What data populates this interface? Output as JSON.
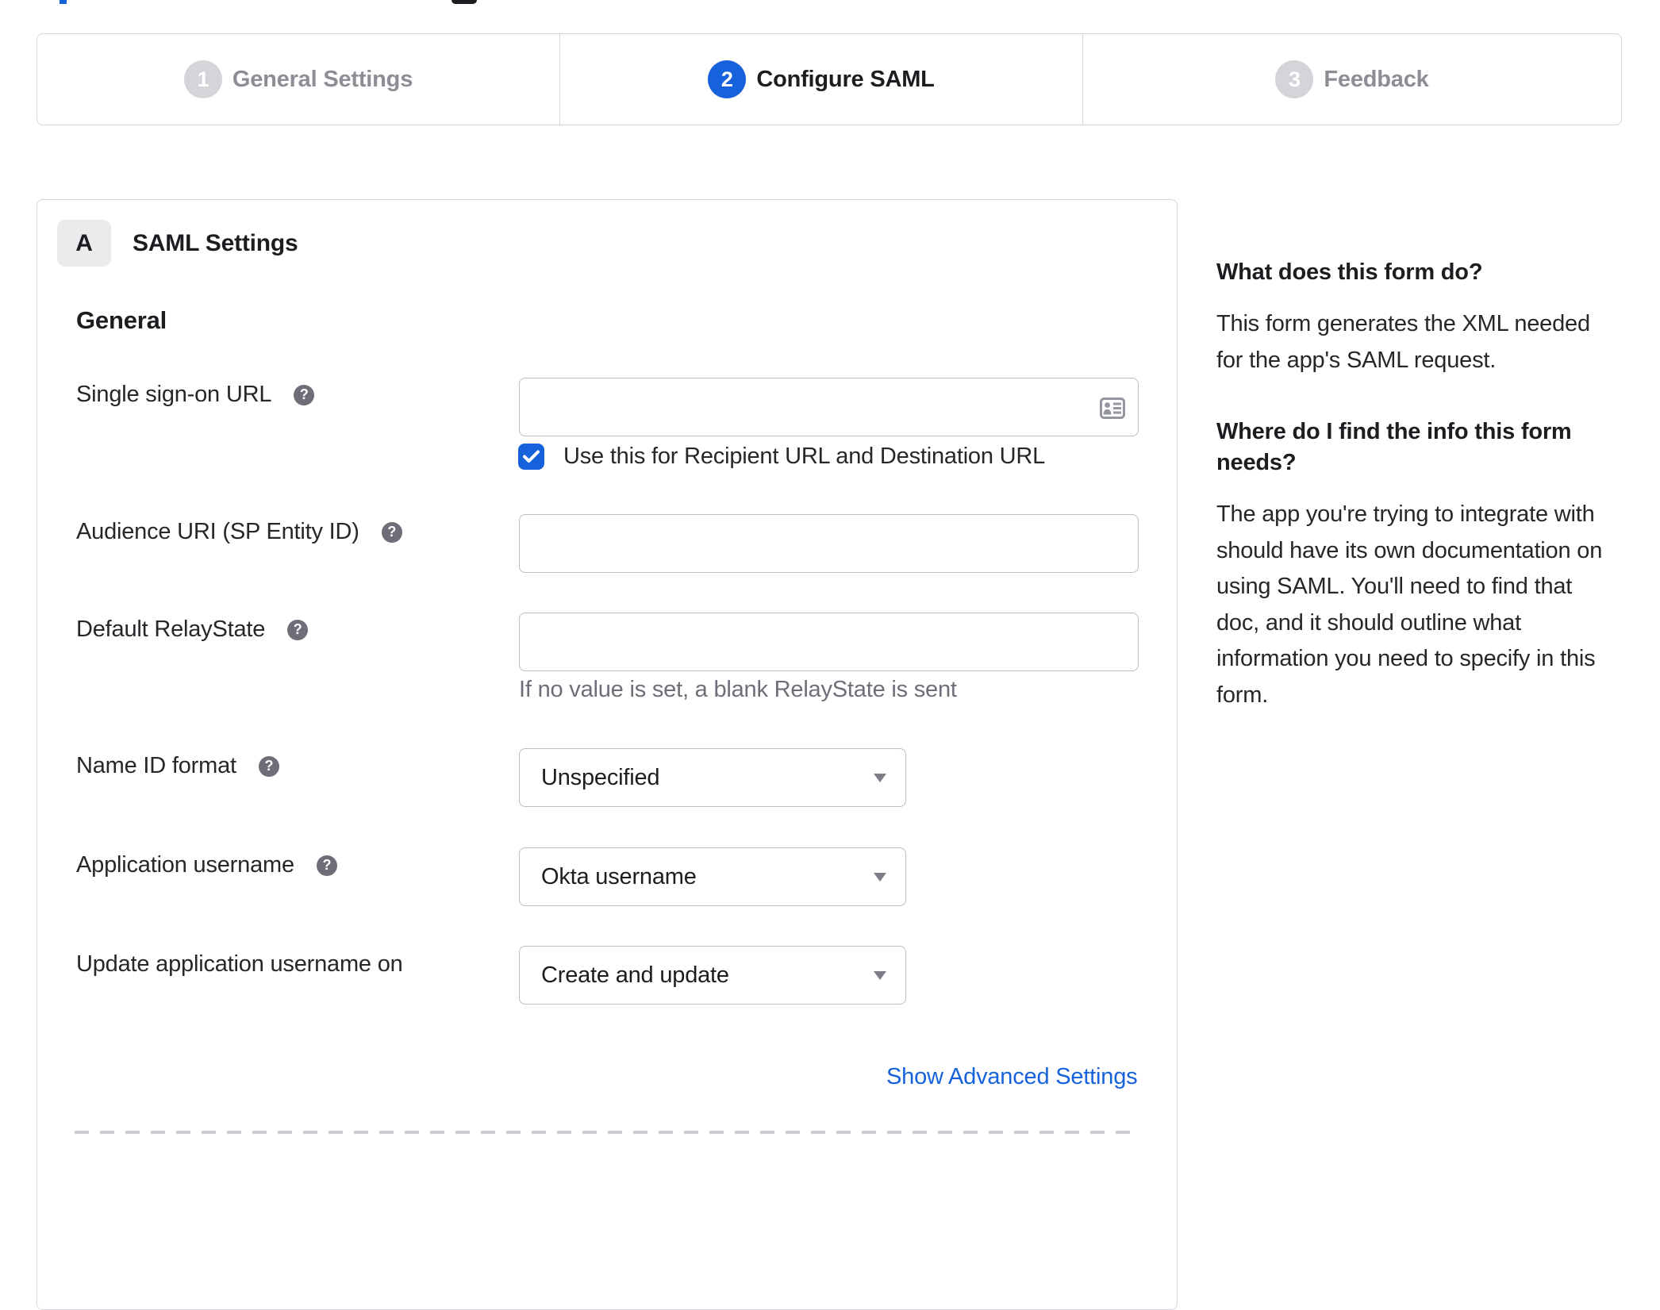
{
  "top_fragments": {
    "note": "bottom edge of page title scrolled out of view"
  },
  "stepper": {
    "steps": [
      {
        "number": "1",
        "label": "General Settings",
        "state": "inactive"
      },
      {
        "number": "2",
        "label": "Configure SAML",
        "state": "active"
      },
      {
        "number": "3",
        "label": "Feedback",
        "state": "inactive"
      }
    ]
  },
  "form": {
    "section_letter": "A",
    "section_title": "SAML Settings",
    "group_title": "General",
    "sso": {
      "label": "Single sign-on URL",
      "value": "",
      "checkbox_label": "Use this for Recipient URL and Destination URL",
      "checkbox_checked": true
    },
    "audience": {
      "label": "Audience URI (SP Entity ID)",
      "value": ""
    },
    "relay": {
      "label": "Default RelayState",
      "value": "",
      "help": "If no value is set, a blank RelayState is sent"
    },
    "name_id": {
      "label": "Name ID format",
      "value": "Unspecified"
    },
    "app_username": {
      "label": "Application username",
      "value": "Okta username"
    },
    "update_username": {
      "label": "Update application username on",
      "value": "Create and update"
    },
    "advanced_link": "Show Advanced Settings"
  },
  "sidebar": {
    "heading1": "What does this form do?",
    "para1_lines": [
      "This form generates the XML needed",
      "for the app's SAML request."
    ],
    "heading2_lines": [
      "Where do I find the info this form",
      "needs?"
    ],
    "para2_lines": [
      "The app you're trying to integrate with",
      "should have its own documentation on",
      "using SAML. You'll need to find that",
      "doc, and it should outline what",
      "information you need to specify in this",
      "form."
    ]
  },
  "colors": {
    "accent_blue": "#1662dd",
    "border_gray": "#d7d7dc",
    "input_border": "#bdbdc4",
    "inactive_gray": "#8d8d96",
    "text_dark": "#1d1d21"
  }
}
